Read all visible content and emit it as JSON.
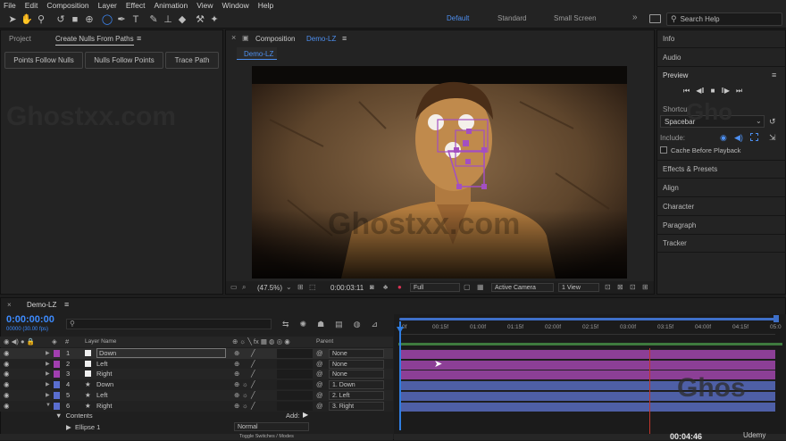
{
  "menu": [
    "File",
    "Edit",
    "Composition",
    "Layer",
    "Effect",
    "Animation",
    "View",
    "Window",
    "Help"
  ],
  "workspaces": {
    "default": "Default",
    "standard": "Standard",
    "small_screen": "Small Screen",
    "more": "»"
  },
  "search_help_placeholder": "Search Help",
  "left_panel": {
    "tab_project": "Project",
    "tab_active": "Create Nulls From Paths",
    "menu_glyph": "≡",
    "buttons": [
      "Points Follow Nulls",
      "Nulls Follow Points",
      "Trace Path"
    ]
  },
  "comp_panel": {
    "close_glyph": "×",
    "tab_label": "Composition",
    "comp_name": "Demo-LZ",
    "menu_glyph": "≡",
    "subtab": "Demo-LZ"
  },
  "viewer_footer": {
    "zoom": "(47.5%)",
    "timecode": "0:00:03:11",
    "resolution": "Full",
    "camera": "Active Camera",
    "views": "1 View"
  },
  "watermark": "Ghostxx.com",
  "right_panel": {
    "info": "Info",
    "audio": "Audio",
    "preview": "Preview",
    "shortcut_label": "Shortcut",
    "shortcut_value": "Spacebar",
    "include_label": "Include:",
    "cache_label": "Cache Before Playback",
    "items": [
      "Effects & Presets",
      "Align",
      "Character",
      "Paragraph",
      "Tracker"
    ]
  },
  "timeline": {
    "tab": "Demo-LZ",
    "menu_glyph": "≡",
    "current_time": "0:00:00:00",
    "frame_info": "00000 (30.00 fps)",
    "col_num": "#",
    "col_layer_name": "Layer Name",
    "col_parent": "Parent",
    "ruler": [
      "0f",
      "00:15f",
      "01:00f",
      "01:15f",
      "02:00f",
      "02:15f",
      "03:00f",
      "03:15f",
      "04:00f",
      "04:15f",
      "05:0"
    ],
    "layers": [
      {
        "num": "1",
        "name": "Down",
        "parent": "None",
        "color": "#a13fb0",
        "type": "solid"
      },
      {
        "num": "2",
        "name": "Left",
        "parent": "None",
        "color": "#a13fb0",
        "type": "solid"
      },
      {
        "num": "3",
        "name": "Right",
        "parent": "None",
        "color": "#a13fb0",
        "type": "solid"
      },
      {
        "num": "4",
        "name": "Down",
        "parent": "1. Down",
        "color": "#5a6ecf",
        "type": "shape"
      },
      {
        "num": "5",
        "name": "Left",
        "parent": "2. Left",
        "color": "#5a6ecf",
        "type": "shape"
      },
      {
        "num": "6",
        "name": "Right",
        "parent": "3. Right",
        "color": "#5a6ecf",
        "type": "shape"
      }
    ],
    "contents_label": "Contents",
    "add_label": "Add:",
    "ellipse_label": "Ellipse 1",
    "blend_mode": "Normal",
    "toggle_label": "Toggle Switches / Modes",
    "bottom_time": "00:04:46",
    "brand": "Udemy"
  },
  "colors": {
    "accent": "#3d8bff",
    "solid_bar": "#8c3f96",
    "shape_bar": "#4e5fa6",
    "playhead": "#2f7de0",
    "time_marker": "#c0362c"
  }
}
